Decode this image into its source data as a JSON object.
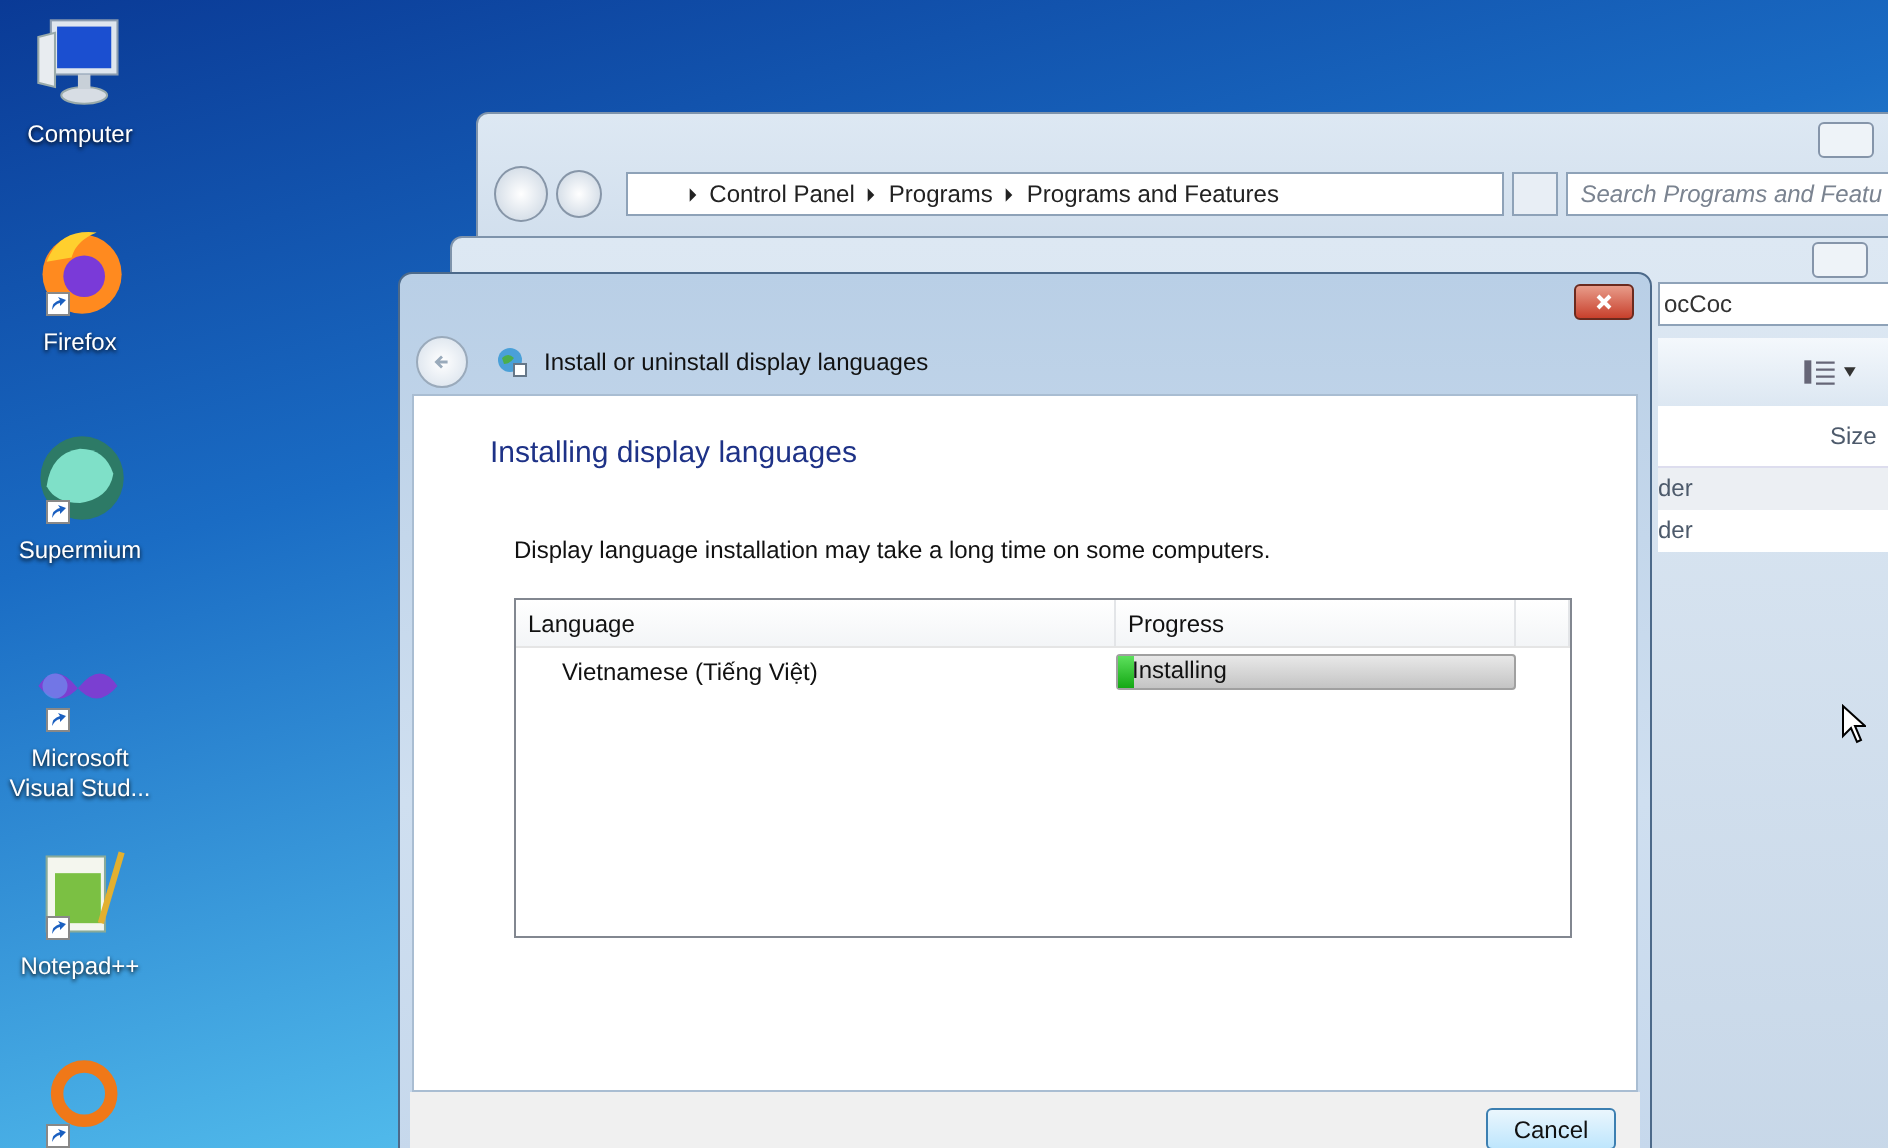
{
  "desktop_icons": [
    {
      "kind": "computer",
      "label": "Computer"
    },
    {
      "kind": "firefox",
      "label": "Firefox",
      "shortcut": true
    },
    {
      "kind": "supermium",
      "label": "Supermium",
      "shortcut": true
    },
    {
      "kind": "visualstudio",
      "label": "Microsoft Visual Stud...",
      "shortcut": true
    },
    {
      "kind": "notepad",
      "label": "Notepad++",
      "shortcut": true
    },
    {
      "kind": "ring",
      "shortcut": true
    }
  ],
  "background_window_1": {
    "breadcrumb": [
      "Control Panel",
      "Programs",
      "Programs and Features"
    ],
    "search": {
      "placeholder": "Search Programs and Featu"
    }
  },
  "background_window_2": {
    "address": "ocCoc",
    "column": "Size",
    "rows": [
      "der",
      "der"
    ]
  },
  "dialog": {
    "title": "Install or uninstall display languages",
    "heading": "Installing display languages",
    "message": "Display language installation may take a long time on some computers.",
    "columns": [
      "Language",
      "Progress"
    ],
    "rows": [
      {
        "language": "Vietnamese (Tiếng Việt)",
        "status": "Installing",
        "level": 0.04
      }
    ],
    "buttons": [
      "Cancel"
    ]
  }
}
